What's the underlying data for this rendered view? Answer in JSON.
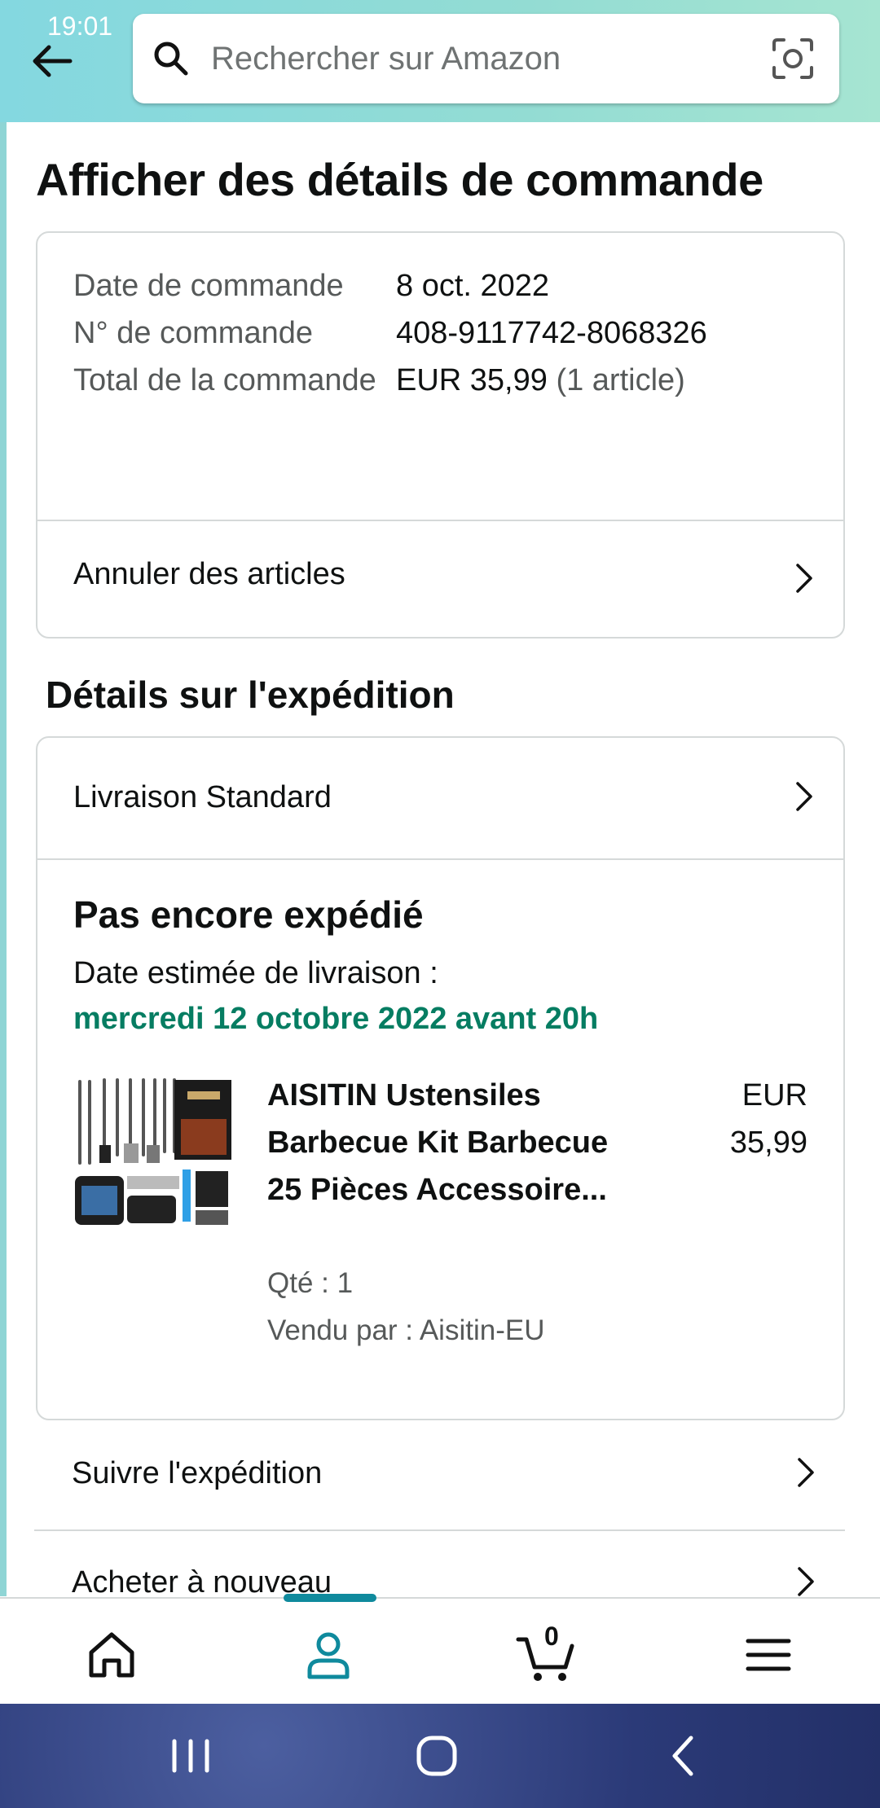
{
  "status_bar": {
    "time": "19:01"
  },
  "header": {
    "search_placeholder": "Rechercher sur Amazon"
  },
  "page": {
    "title": "Afficher des détails de commande"
  },
  "order_info": {
    "date_label": "Date de commande",
    "date_value": "8 oct. 2022",
    "number_label": "N° de commande",
    "number_value": "408-9117742-8068326",
    "total_label": "Total de la commande",
    "total_value": "EUR 35,99",
    "total_count": "(1 article)",
    "cancel_link": "Annuler des articles"
  },
  "shipment": {
    "section_title": "Détails sur l'expédition",
    "method": "Livraison Standard",
    "status": "Pas encore expédié",
    "eta_label": "Date estimée de livraison :",
    "eta_date": "mercredi 12 octobre 2022 avant 20h",
    "product": {
      "title": "AISITIN Ustensiles Barbecue Kit Barbecue 25 Pièces Accessoire...",
      "price_currency": "EUR",
      "price_amount": "35,99",
      "qty": "Qté : 1",
      "seller": "Vendu par : Aisitin-EU"
    }
  },
  "actions": {
    "track": "Suivre l'expédition",
    "buy_again": "Acheter à nouveau"
  },
  "bottom_nav": {
    "items": [
      "home-icon",
      "account-icon",
      "cart-icon",
      "menu-icon"
    ],
    "cart_count": "0",
    "active": "account-icon",
    "accent_color": "#0f8a9d"
  },
  "colors": {
    "eta_green": "#067d62",
    "header_gradient_start": "#84d8e0",
    "header_gradient_end": "#a6e5d2"
  }
}
